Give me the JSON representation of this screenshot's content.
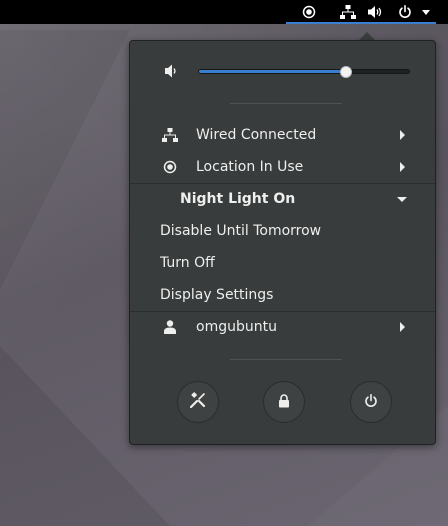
{
  "topbar": {
    "indicators": [
      {
        "name": "location-icon"
      },
      {
        "name": "network-wired-icon"
      },
      {
        "name": "volume-icon"
      },
      {
        "name": "power-icon"
      }
    ],
    "accent_color": "#3a7fcf"
  },
  "menu": {
    "volume": {
      "icon": "volume-low-icon",
      "level": 0.7
    },
    "items": {
      "wired": {
        "label": "Wired Connected",
        "icon": "network-wired-icon"
      },
      "location": {
        "label": "Location In Use",
        "icon": "location-icon"
      },
      "night_light": {
        "label": "Night Light On",
        "submenu": [
          "Disable Until Tomorrow",
          "Turn Off",
          "Display Settings"
        ]
      },
      "user": {
        "label": "omgubuntu",
        "icon": "user-icon"
      }
    },
    "system_buttons": [
      {
        "name": "settings-button",
        "icon": "settings-tools-icon"
      },
      {
        "name": "lock-button",
        "icon": "lock-icon"
      },
      {
        "name": "power-off-button",
        "icon": "power-icon"
      }
    ]
  }
}
